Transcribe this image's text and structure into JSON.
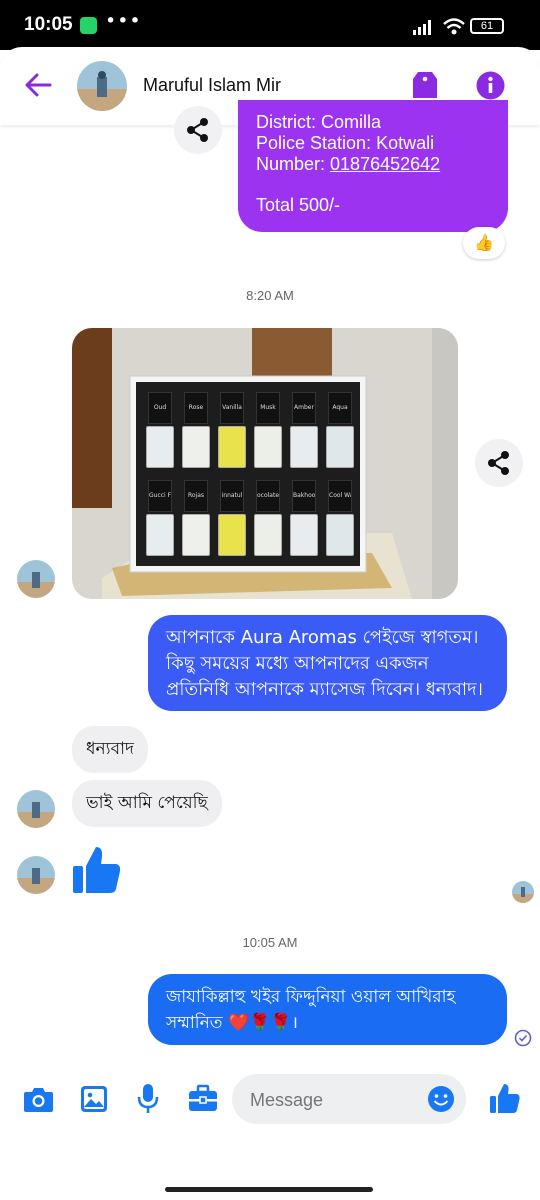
{
  "status": {
    "time": "10:05",
    "battery": "61",
    "dots": "•••"
  },
  "header": {
    "contact_name": "Maruful Islam Mir"
  },
  "messages": {
    "order_lines": [
      "District: Comilla",
      "Police Station: Kotwali",
      "Number: ",
      "Total 500/-"
    ],
    "order_number": "01876452642",
    "reaction": "👍",
    "ts1": "8:20 AM",
    "welcome": "আপনাকে Aura Aromas পেইজে স্বাগতম। কিছু সময়ের মধ্যে আপনাদের একজন প্রতিনিধি আপনাকে ম্যাসেজ দিবেন। ধন্যবাদ।",
    "in1": "ধন্যবাদ",
    "in2": "ভাই আমি পেয়েছি",
    "ts2": "10:05 AM",
    "last_out": "জাযাকিল্লাহু খইর ফিদ্দুনিয়া ওয়াল আখিরাহ সম্মানিত ❤️🌹🌹।"
  },
  "product_photo": {
    "bottle_labels": [
      "Oud",
      "Rose",
      "Vanilla",
      "Musk",
      "Amber",
      "Aqua",
      "Gucci Fl",
      "Rojas",
      "innatul",
      "ocolate",
      "Bakhoo",
      "Cool Wa"
    ]
  },
  "composer": {
    "placeholder": "Message"
  },
  "colors": {
    "accent": "#8a2be2",
    "out_purple": "#9b33f0",
    "out_blue": "#3b5bf6",
    "like_blue": "#1877f2"
  }
}
